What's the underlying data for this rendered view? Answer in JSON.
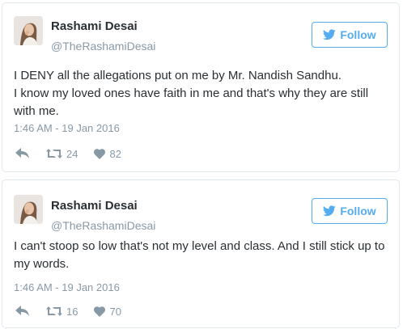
{
  "tweets": [
    {
      "name": "Rashami Desai",
      "handle": "@TheRashamiDesai",
      "follow_label": "Follow",
      "text_lines": [
        "I DENY all the allegations put on me by Mr. Nandish Sandhu.",
        "I know my loved ones have faith in me and that's why they are still with me."
      ],
      "timestamp": "1:46 AM - 19 Jan 2016",
      "retweets": "24",
      "likes": "82"
    },
    {
      "name": "Rashami Desai",
      "handle": "@TheRashamiDesai",
      "follow_label": "Follow",
      "text_lines": [
        "I can't stoop so low that's not my level and class. And I still stick up to my words."
      ],
      "timestamp": "1:46 AM - 19 Jan 2016",
      "retweets": "16",
      "likes": "70"
    }
  ],
  "icons": {
    "follow": "bird-icon",
    "reply": "reply-icon",
    "retweet": "retweet-icon",
    "like": "heart-icon"
  },
  "colors": {
    "accent": "#55acee",
    "muted": "#8899a6",
    "text": "#292f33",
    "border": "#e1e8ed"
  }
}
